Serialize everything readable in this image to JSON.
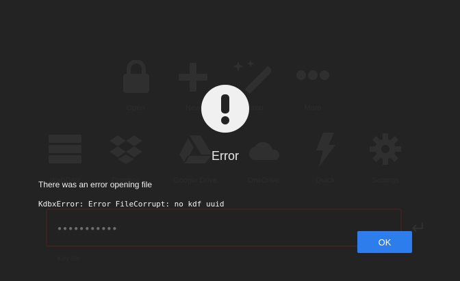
{
  "background": {
    "tiles": [
      {
        "icon": "lock-icon",
        "label": "Open"
      },
      {
        "icon": "plus-icon",
        "label": "New"
      },
      {
        "icon": "magic-wand-icon",
        "label": "Demo"
      },
      {
        "icon": "more-icon",
        "label": "More"
      },
      {
        "icon": "server-icon",
        "label": "WebDAV"
      },
      {
        "icon": "dropbox-icon",
        "label": "Dropbox"
      },
      {
        "icon": "google-drive-icon",
        "label": "Google Drive"
      },
      {
        "icon": "onedrive-icon",
        "label": "OneDrive"
      },
      {
        "icon": "flash-icon",
        "label": "Quick"
      },
      {
        "icon": "gear-icon",
        "label": "Settings"
      }
    ],
    "password_dots": "●●●●●●●●●●●",
    "keyfile_label": "Key file"
  },
  "modal": {
    "title": "Error",
    "message": "There was an error opening file",
    "details": "KdbxError: Error FileCorrupt: no kdf uuid",
    "ok_label": "OK"
  },
  "colors": {
    "overlay_bg": "#232323",
    "button": "#2e7dec",
    "text": "#f2f2f2"
  }
}
